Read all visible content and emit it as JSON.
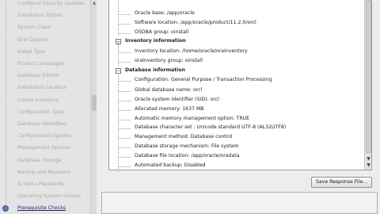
{
  "steps": [
    {
      "label": "Configure Security Updates",
      "state": "done"
    },
    {
      "label": "Installation Option",
      "state": "done"
    },
    {
      "label": "System Class",
      "state": "done"
    },
    {
      "label": "Grid Options",
      "state": "done"
    },
    {
      "label": "Install Type",
      "state": "done"
    },
    {
      "label": "Product Languages",
      "state": "done"
    },
    {
      "label": "Database Edition",
      "state": "done"
    },
    {
      "label": "Installation Location",
      "state": "done"
    },
    {
      "label": "Create Inventory",
      "state": "done"
    },
    {
      "label": "Configuration Type",
      "state": "done"
    },
    {
      "label": "Database Identifiers",
      "state": "done"
    },
    {
      "label": "Configuration Options",
      "state": "done"
    },
    {
      "label": "Management Options",
      "state": "done"
    },
    {
      "label": "Database Storage",
      "state": "done"
    },
    {
      "label": "Backup and Recovery",
      "state": "done"
    },
    {
      "label": "Schema Passwords",
      "state": "done"
    },
    {
      "label": "Operating System Groups",
      "state": "done"
    },
    {
      "label": "Prerequisite Checks",
      "state": "active"
    }
  ],
  "tree": {
    "rows": [
      {
        "kind": "item",
        "text": "Oracle base: /app/oracle"
      },
      {
        "kind": "item",
        "text": "Software location: /app/oracle/product/11.2.0/orcl"
      },
      {
        "kind": "item",
        "text": "OSDBA group: oinstall"
      },
      {
        "kind": "section",
        "text": "Inventory information",
        "toggle": "−"
      },
      {
        "kind": "item",
        "text": "Inventory location: /home/oracle/oraInventory"
      },
      {
        "kind": "item",
        "text": "oraInventory group: oinstall"
      },
      {
        "kind": "section",
        "text": "Database information",
        "toggle": "−"
      },
      {
        "kind": "item",
        "text": "Configuration: General Purpose / Transaction Processing"
      },
      {
        "kind": "item",
        "text": "Global database name: orcl"
      },
      {
        "kind": "item",
        "text": "Oracle system identifier (SID): orcl"
      },
      {
        "kind": "item",
        "text": "Allocated memory: 1637  MB"
      },
      {
        "kind": "item",
        "text": "Automatic memory management option: TRUE"
      },
      {
        "kind": "item",
        "text": "Database character set : Unicode standard UTF-8 (AL32UTF8)"
      },
      {
        "kind": "item",
        "text": "Management method: Database control"
      },
      {
        "kind": "item",
        "text": "Database storage mechanism: File system"
      },
      {
        "kind": "item",
        "text": "Database file location: /app/oracle/oradata"
      },
      {
        "kind": "item",
        "text": "Automated backup: Disabled"
      }
    ]
  },
  "buttons": {
    "save_response": "Save Response File..."
  }
}
